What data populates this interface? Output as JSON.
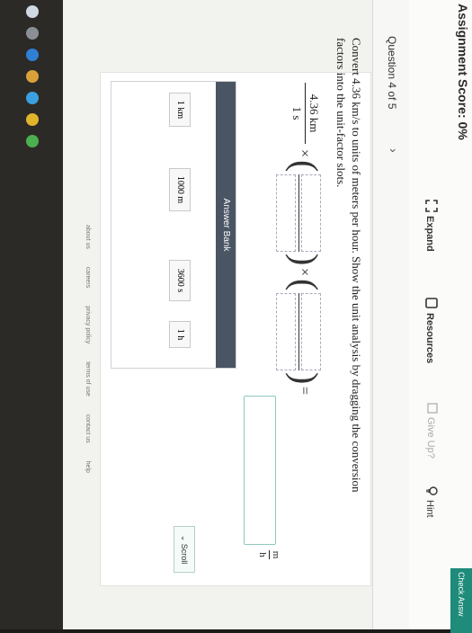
{
  "header": {
    "score_label": "Assignment Score: 0%",
    "expand_label": "Expand",
    "resources_label": "Resources",
    "giveup_label": "Give Up?",
    "hint_label": "Hint",
    "check_label": "Check Answ"
  },
  "question": {
    "number_label": "Question 4 of 5",
    "next_icon": "chevron-right-icon",
    "prompt": "Convert 4.36 km/s to units of meters per hour. Show the unit analysis by dragging the conversion factors into the unit-factor slots.",
    "given_numerator": "4.36 km",
    "given_denominator": "1 s",
    "times": "×",
    "equals": "=",
    "answer_unit_numerator": "m",
    "answer_unit_denominator": "h"
  },
  "answer_bank": {
    "title": "Answer Bank",
    "chips": [
      "1 km",
      "1000 m",
      "3600 s",
      "1 h"
    ]
  },
  "scroll_label": "Scroll",
  "footer_links": [
    "about us",
    "careers",
    "privacy policy",
    "terms of use",
    "contact us",
    "help"
  ],
  "colors": {
    "accent": "#1f8b7a",
    "bank_header": "#4a5563"
  }
}
